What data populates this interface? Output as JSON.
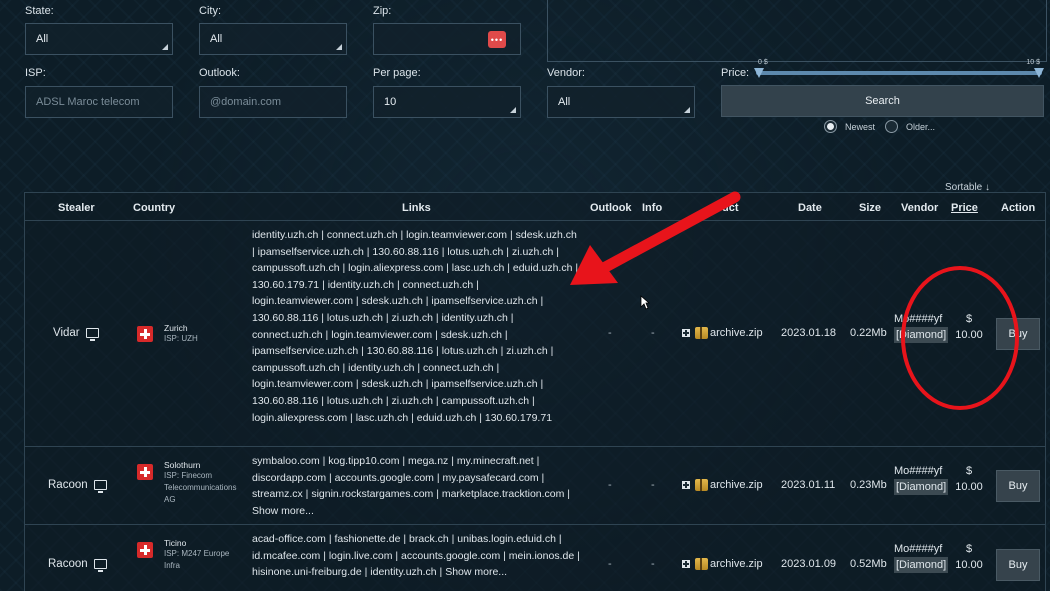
{
  "filters": {
    "state": {
      "label": "State:",
      "value": "All"
    },
    "city": {
      "label": "City:",
      "value": "All"
    },
    "zip": {
      "label": "Zip:",
      "button": "•••"
    },
    "isp": {
      "label": "ISP:",
      "placeholder": "ADSL Maroc telecom"
    },
    "outlook": {
      "label": "Outlook:",
      "placeholder": "@domain.com"
    },
    "per_page": {
      "label": "Per page:",
      "value": "10"
    },
    "vendor": {
      "label": "Vendor:",
      "value": "All"
    },
    "price": {
      "label": "Price:",
      "min": "0 $",
      "max": "10 $"
    },
    "search_button": "Search",
    "sort_options": [
      {
        "label": "Newest",
        "selected": true
      },
      {
        "label": "Older...",
        "selected": false
      }
    ]
  },
  "table": {
    "sortable_label": "Sortable ↓",
    "columns": [
      "Stealer",
      "Country",
      "Links",
      "Outlook",
      "Info",
      "uct",
      "Date",
      "Size",
      "Vendor",
      "Price",
      "Action"
    ],
    "rows": [
      {
        "stealer": "Vidar",
        "city": "Zurich",
        "isp": "ISP: UZH",
        "links": "identity.uzh.ch | connect.uzh.ch | login.teamviewer.com | sdesk.uzh.ch | ipamselfservice.uzh.ch | 130.60.88.116 | lotus.uzh.ch | zi.uzh.ch | campussoft.uzh.ch | login.aliexpress.com | lasc.uzh.ch | eduid.uzh.ch | 130.60.179.71 | identity.uzh.ch | connect.uzh.ch | login.teamviewer.com | sdesk.uzh.ch | ipamselfservice.uzh.ch | 130.60.88.116 | lotus.uzh.ch | zi.uzh.ch | identity.uzh.ch | connect.uzh.ch | login.teamviewer.com | sdesk.uzh.ch | ipamselfservice.uzh.ch | 130.60.88.116 | lotus.uzh.ch | zi.uzh.ch | campussoft.uzh.ch | identity.uzh.ch | connect.uzh.ch | login.teamviewer.com | sdesk.uzh.ch | ipamselfservice.uzh.ch | 130.60.88.116 | lotus.uzh.ch | zi.uzh.ch | campussoft.uzh.ch | login.aliexpress.com | lasc.uzh.ch | eduid.uzh.ch | 130.60.179.71",
        "outlook": "-",
        "info": "-",
        "product": "archive.zip",
        "date": "2023.01.18",
        "size": "0.22Mb",
        "vendor_name": "Mo####yf",
        "vendor_badge": "[Diamond]",
        "price_currency": "$",
        "price_value": "10.00",
        "action": "Buy"
      },
      {
        "stealer": "Racoon",
        "city": "Solothurn",
        "isp": "ISP: Finecom Telecommunications AG",
        "links": "symbaloo.com | kog.tipp10.com | mega.nz | my.minecraft.net | discordapp.com | accounts.google.com | my.paysafecard.com | streamz.cx | signin.rockstargames.com | marketplace.tracktion.com | Show more...",
        "outlook": "-",
        "info": "-",
        "product": "archive.zip",
        "date": "2023.01.11",
        "size": "0.23Mb",
        "vendor_name": "Mo####yf",
        "vendor_badge": "[Diamond]",
        "price_currency": "$",
        "price_value": "10.00",
        "action": "Buy"
      },
      {
        "stealer": "Racoon",
        "city": "Ticino",
        "isp": "ISP: M247 Europe Infra",
        "links": "acad-office.com | fashionette.de | brack.ch | unibas.login.eduid.ch | id.mcafee.com | login.live.com | accounts.google.com | mein.ionos.de | hisinone.uni-freiburg.de | identity.uzh.ch | Show more...",
        "outlook": "-",
        "info": "-",
        "product": "archive.zip",
        "date": "2023.01.09",
        "size": "0.52Mb",
        "vendor_name": "Mo####yf",
        "vendor_badge": "[Diamond]",
        "price_currency": "$",
        "price_value": "10.00",
        "action": "Buy"
      }
    ]
  },
  "colors": {
    "annotation_red": "#e8141b",
    "accent_blue": "#5d89ad"
  }
}
